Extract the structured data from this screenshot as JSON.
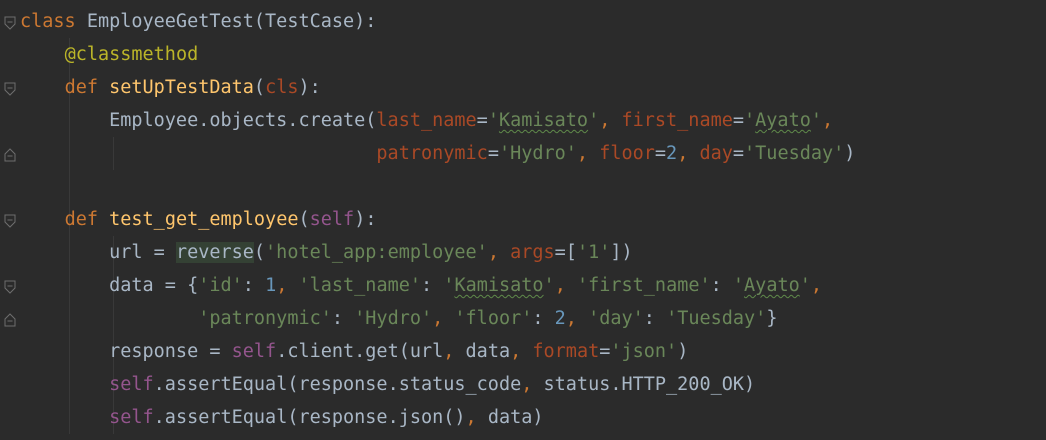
{
  "code": {
    "lines": [
      [
        {
          "t": "class ",
          "c": "kw"
        },
        {
          "t": "EmployeeGetTest",
          "c": "plain"
        },
        {
          "t": "(TestCase):",
          "c": "plain"
        }
      ],
      [
        {
          "t": "    ",
          "c": "plain"
        },
        {
          "t": "@classmethod",
          "c": "dec"
        }
      ],
      [
        {
          "t": "    ",
          "c": "plain"
        },
        {
          "t": "def ",
          "c": "kw"
        },
        {
          "t": "setUpTestData",
          "c": "fn"
        },
        {
          "t": "(",
          "c": "plain"
        },
        {
          "t": "cls",
          "c": "param"
        },
        {
          "t": "):",
          "c": "plain"
        }
      ],
      [
        {
          "t": "        Employee.objects.create(",
          "c": "plain"
        },
        {
          "t": "last_name",
          "c": "named"
        },
        {
          "t": "=",
          "c": "plain"
        },
        {
          "t": "'",
          "c": "str"
        },
        {
          "t": "Kamisato",
          "c": "str typo"
        },
        {
          "t": "'",
          "c": "str"
        },
        {
          "t": ", ",
          "c": "kw"
        },
        {
          "t": "first_name",
          "c": "named"
        },
        {
          "t": "=",
          "c": "plain"
        },
        {
          "t": "'",
          "c": "str"
        },
        {
          "t": "Ayato",
          "c": "str typo"
        },
        {
          "t": "'",
          "c": "str"
        },
        {
          "t": ",",
          "c": "kw"
        }
      ],
      [
        {
          "t": "                                ",
          "c": "plain"
        },
        {
          "t": "patronymic",
          "c": "named"
        },
        {
          "t": "=",
          "c": "plain"
        },
        {
          "t": "'Hydro'",
          "c": "str"
        },
        {
          "t": ", ",
          "c": "kw"
        },
        {
          "t": "floor",
          "c": "named"
        },
        {
          "t": "=",
          "c": "plain"
        },
        {
          "t": "2",
          "c": "num"
        },
        {
          "t": ", ",
          "c": "kw"
        },
        {
          "t": "day",
          "c": "named"
        },
        {
          "t": "=",
          "c": "plain"
        },
        {
          "t": "'Tuesday'",
          "c": "str"
        },
        {
          "t": ")",
          "c": "plain"
        }
      ],
      [],
      [
        {
          "t": "    ",
          "c": "plain"
        },
        {
          "t": "def ",
          "c": "kw"
        },
        {
          "t": "test_get_employee",
          "c": "fn"
        },
        {
          "t": "(",
          "c": "plain"
        },
        {
          "t": "self",
          "c": "selfk"
        },
        {
          "t": "):",
          "c": "plain"
        }
      ],
      [
        {
          "t": "        url = ",
          "c": "plain"
        },
        {
          "t": "reverse",
          "c": "plain hl"
        },
        {
          "t": "(",
          "c": "plain"
        },
        {
          "t": "'hotel_app:employee'",
          "c": "str"
        },
        {
          "t": ", ",
          "c": "kw"
        },
        {
          "t": "args",
          "c": "named"
        },
        {
          "t": "=[",
          "c": "plain"
        },
        {
          "t": "'1'",
          "c": "str"
        },
        {
          "t": "])",
          "c": "plain"
        }
      ],
      [
        {
          "t": "        data = {",
          "c": "plain"
        },
        {
          "t": "'id'",
          "c": "str"
        },
        {
          "t": ": ",
          "c": "plain"
        },
        {
          "t": "1",
          "c": "num"
        },
        {
          "t": ", ",
          "c": "kw"
        },
        {
          "t": "'last_name'",
          "c": "str"
        },
        {
          "t": ": ",
          "c": "plain"
        },
        {
          "t": "'",
          "c": "str"
        },
        {
          "t": "Kamisato",
          "c": "str typo"
        },
        {
          "t": "'",
          "c": "str"
        },
        {
          "t": ", ",
          "c": "kw"
        },
        {
          "t": "'first_name'",
          "c": "str"
        },
        {
          "t": ": ",
          "c": "plain"
        },
        {
          "t": "'",
          "c": "str"
        },
        {
          "t": "Ayato",
          "c": "str typo"
        },
        {
          "t": "'",
          "c": "str"
        },
        {
          "t": ",",
          "c": "kw"
        }
      ],
      [
        {
          "t": "                ",
          "c": "plain"
        },
        {
          "t": "'patronymic'",
          "c": "str"
        },
        {
          "t": ": ",
          "c": "plain"
        },
        {
          "t": "'Hydro'",
          "c": "str"
        },
        {
          "t": ", ",
          "c": "kw"
        },
        {
          "t": "'floor'",
          "c": "str"
        },
        {
          "t": ": ",
          "c": "plain"
        },
        {
          "t": "2",
          "c": "num"
        },
        {
          "t": ", ",
          "c": "kw"
        },
        {
          "t": "'day'",
          "c": "str"
        },
        {
          "t": ": ",
          "c": "plain"
        },
        {
          "t": "'Tuesday'",
          "c": "str"
        },
        {
          "t": "}",
          "c": "plain"
        }
      ],
      [
        {
          "t": "        response = ",
          "c": "plain"
        },
        {
          "t": "self",
          "c": "selfk"
        },
        {
          "t": ".client.get(url",
          "c": "plain"
        },
        {
          "t": ", ",
          "c": "kw"
        },
        {
          "t": "data",
          "c": "plain"
        },
        {
          "t": ", ",
          "c": "kw"
        },
        {
          "t": "format",
          "c": "named"
        },
        {
          "t": "=",
          "c": "plain"
        },
        {
          "t": "'json'",
          "c": "str"
        },
        {
          "t": ")",
          "c": "plain"
        }
      ],
      [
        {
          "t": "        ",
          "c": "plain"
        },
        {
          "t": "self",
          "c": "selfk"
        },
        {
          "t": ".assertEqual(response.status_code",
          "c": "plain"
        },
        {
          "t": ", ",
          "c": "kw"
        },
        {
          "t": "status.HTTP_200_OK)",
          "c": "plain"
        }
      ],
      [
        {
          "t": "        ",
          "c": "plain"
        },
        {
          "t": "self",
          "c": "selfk"
        },
        {
          "t": ".assertEqual(response.json()",
          "c": "plain"
        },
        {
          "t": ", ",
          "c": "kw"
        },
        {
          "t": "data)",
          "c": "plain"
        }
      ]
    ]
  },
  "gutter": {
    "fold_markers": [
      {
        "line": 0,
        "kind": "open"
      },
      {
        "line": 2,
        "kind": "open"
      },
      {
        "line": 4,
        "kind": "close"
      },
      {
        "line": 6,
        "kind": "open"
      },
      {
        "line": 8,
        "kind": "open"
      },
      {
        "line": 9,
        "kind": "close"
      }
    ]
  },
  "colors": {
    "background": "#2b2b2b",
    "keyword": "#cc7832",
    "function": "#ffc66d",
    "decorator": "#bbb529",
    "string": "#6a8759",
    "number": "#6897bb",
    "parameter": "#aa4926",
    "self": "#94558d",
    "default_text": "#a9b7c6"
  }
}
